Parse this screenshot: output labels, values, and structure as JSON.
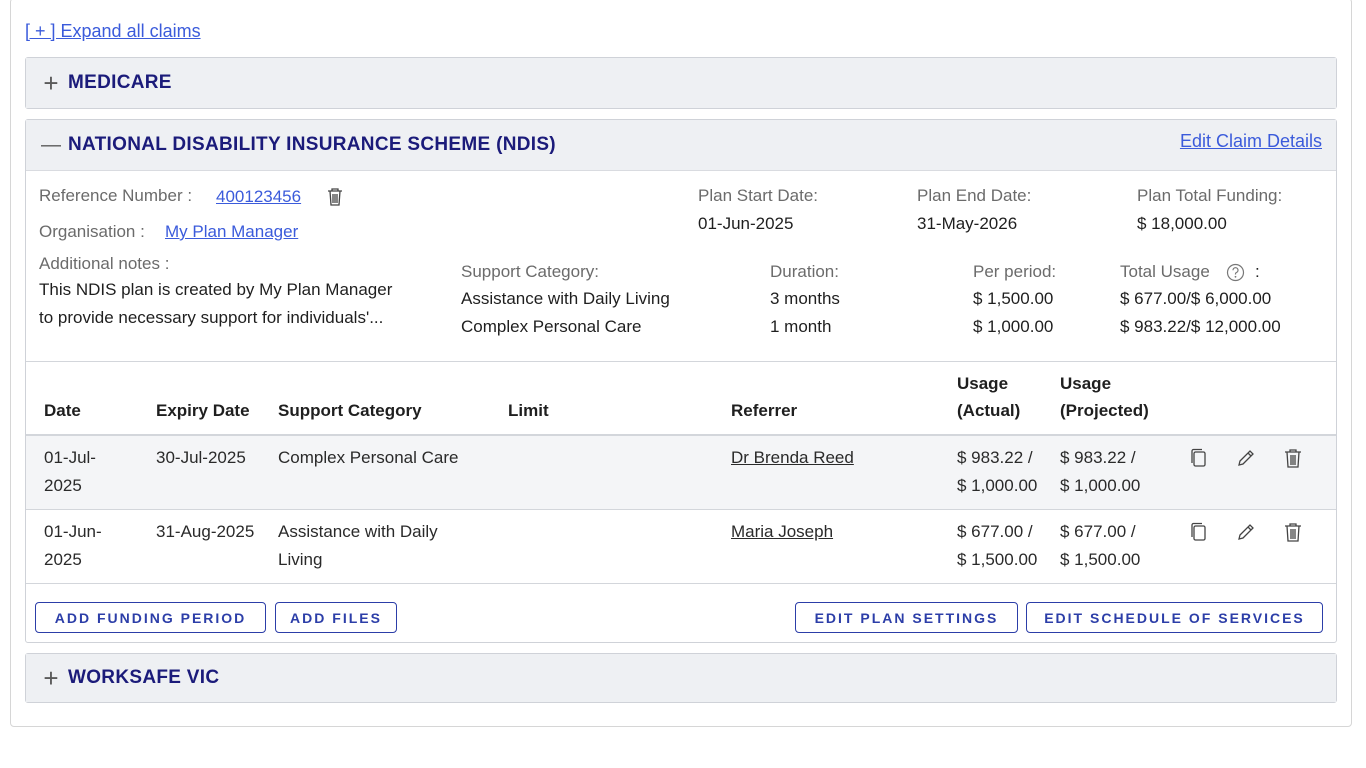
{
  "expand_all": "[ + ] Expand all claims",
  "panels": {
    "medicare": {
      "sign": "+",
      "title": "MEDICARE"
    },
    "ndis": {
      "sign": "—",
      "title": "NATIONAL DISABILITY INSURANCE SCHEME (NDIS)",
      "edit_claim": "Edit Claim Details",
      "reference_label": "Reference Number :",
      "reference_value": "400123456",
      "organisation_label": "Organisation :",
      "organisation_value": "My Plan Manager",
      "notes_label": "Additional notes :",
      "notes_line1": "This NDIS plan is created by My Plan Manager",
      "notes_line2": "to provide necessary support for individuals'...",
      "plan_start_label": "Plan Start Date:",
      "plan_start_value": "01-Jun-2025",
      "plan_end_label": "Plan End Date:",
      "plan_end_value": "31-May-2026",
      "plan_total_label": "Plan Total Funding:",
      "plan_total_value": "$ 18,000.00",
      "support_header": "Support Category:",
      "duration_header": "Duration:",
      "per_period_header": "Per period:",
      "total_usage_header": "Total Usage",
      "total_usage_colon": ":",
      "supports": [
        {
          "category": "Assistance with Daily Living",
          "duration": "3 months",
          "per_period": "$ 1,500.00",
          "total_usage": "$ 677.00/$ 6,000.00"
        },
        {
          "category": "Complex Personal Care",
          "duration": "1 month",
          "per_period": "$ 1,000.00",
          "total_usage": "$ 983.22/$ 12,000.00"
        }
      ],
      "table": {
        "headers": {
          "date": "Date",
          "expiry": "Expiry Date",
          "category": "Support Category",
          "limit": "Limit",
          "referrer": "Referrer",
          "usage_actual_1": "Usage",
          "usage_actual_2": "(Actual)",
          "usage_projected_1": "Usage",
          "usage_projected_2": "(Projected)"
        },
        "rows": [
          {
            "date_1": "01-Jul-",
            "date_2": "2025",
            "expiry": "30-Jul-2025",
            "category_1": "Complex Personal Care",
            "category_2": "",
            "limit": "",
            "referrer": "Dr Brenda Reed",
            "actual_1": "$ 983.22 /",
            "actual_2": "$ 1,000.00",
            "projected_1": "$ 983.22 /",
            "projected_2": "$ 1,000.00"
          },
          {
            "date_1": "01-Jun-",
            "date_2": "2025",
            "expiry": "31-Aug-2025",
            "category_1": "Assistance with Daily",
            "category_2": "Living",
            "limit": "",
            "referrer": "Maria Joseph",
            "actual_1": "$ 677.00 /",
            "actual_2": "$ 1,500.00",
            "projected_1": "$ 677.00 /",
            "projected_2": "$ 1,500.00"
          }
        ]
      },
      "buttons": {
        "add_funding": "ADD FUNDING PERIOD",
        "add_files": "ADD FILES",
        "edit_plan": "EDIT PLAN SETTINGS",
        "edit_schedule": "EDIT SCHEDULE OF SERVICES"
      }
    },
    "worksafe": {
      "sign": "+",
      "title": "WORKSAFE VIC"
    }
  },
  "colors": {
    "link": "#3b5bdb",
    "title": "#1b1b7a",
    "header_bg": "#eef0f3",
    "button": "#2c3ea8"
  }
}
